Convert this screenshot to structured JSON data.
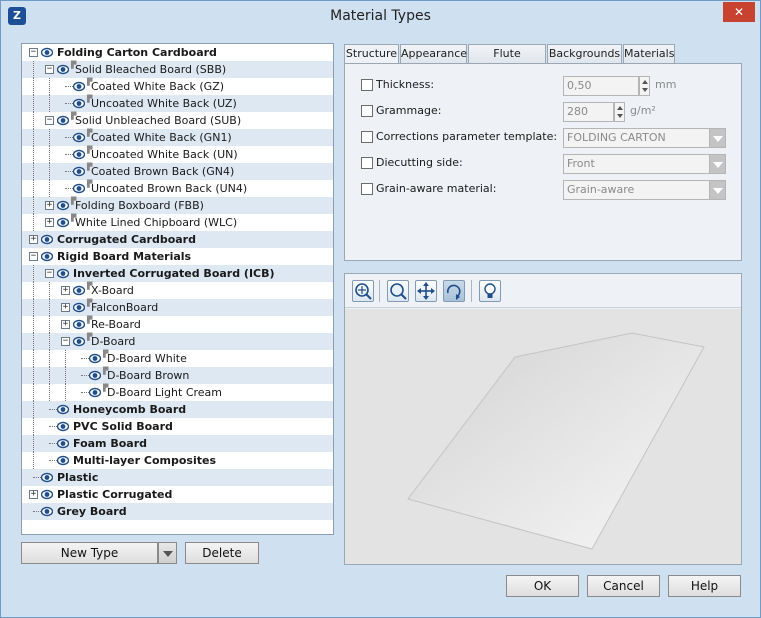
{
  "window": {
    "title": "Material Types",
    "icon_name": "app-logo-icon",
    "close_glyph": "✕"
  },
  "tree": [
    {
      "label": "Folding Carton Cardboard",
      "level": 0,
      "expander": "minus",
      "bold": true,
      "flag": false
    },
    {
      "label": "Solid Bleached Board (SBB)",
      "level": 1,
      "expander": "minus",
      "bold": false,
      "flag": true
    },
    {
      "label": "Coated White Back (GZ)",
      "level": 2,
      "expander": "none",
      "bold": false,
      "flag": true
    },
    {
      "label": "Uncoated White Back (UZ)",
      "level": 2,
      "expander": "none",
      "bold": false,
      "flag": true
    },
    {
      "label": "Solid Unbleached Board (SUB)",
      "level": 1,
      "expander": "minus",
      "bold": false,
      "flag": true
    },
    {
      "label": "Coated White Back (GN1)",
      "level": 2,
      "expander": "none",
      "bold": false,
      "flag": true
    },
    {
      "label": "Uncoated White Back (UN)",
      "level": 2,
      "expander": "none",
      "bold": false,
      "flag": true
    },
    {
      "label": "Coated Brown Back (GN4)",
      "level": 2,
      "expander": "none",
      "bold": false,
      "flag": true
    },
    {
      "label": "Uncoated Brown Back (UN4)",
      "level": 2,
      "expander": "none",
      "bold": false,
      "flag": true
    },
    {
      "label": "Folding Boxboard (FBB)",
      "level": 1,
      "expander": "plus",
      "bold": false,
      "flag": true
    },
    {
      "label": "White Lined Chipboard (WLC)",
      "level": 1,
      "expander": "plus",
      "bold": false,
      "flag": true
    },
    {
      "label": "Corrugated Cardboard",
      "level": 0,
      "expander": "plus",
      "bold": true,
      "flag": false
    },
    {
      "label": "Rigid Board Materials",
      "level": 0,
      "expander": "minus",
      "bold": true,
      "flag": false
    },
    {
      "label": "Inverted Corrugated Board (ICB)",
      "level": 1,
      "expander": "minus",
      "bold": true,
      "flag": false
    },
    {
      "label": "X-Board",
      "level": 2,
      "expander": "plus",
      "bold": false,
      "flag": true
    },
    {
      "label": "FalconBoard",
      "level": 2,
      "expander": "plus",
      "bold": false,
      "flag": true
    },
    {
      "label": "Re-Board",
      "level": 2,
      "expander": "plus",
      "bold": false,
      "flag": true
    },
    {
      "label": "D-Board",
      "level": 2,
      "expander": "minus",
      "bold": false,
      "flag": true
    },
    {
      "label": "D-Board White",
      "level": 3,
      "expander": "none",
      "bold": false,
      "flag": true
    },
    {
      "label": "D-Board Brown",
      "level": 3,
      "expander": "none",
      "bold": false,
      "flag": true
    },
    {
      "label": "D-Board Light Cream",
      "level": 3,
      "expander": "none",
      "bold": false,
      "flag": true
    },
    {
      "label": "Honeycomb Board",
      "level": 1,
      "expander": "none",
      "bold": true,
      "flag": false
    },
    {
      "label": "PVC Solid Board",
      "level": 1,
      "expander": "none",
      "bold": true,
      "flag": false
    },
    {
      "label": "Foam Board",
      "level": 1,
      "expander": "none",
      "bold": true,
      "flag": false
    },
    {
      "label": "Multi-layer Composites",
      "level": 1,
      "expander": "none",
      "bold": true,
      "flag": false
    },
    {
      "label": "Plastic",
      "level": 0,
      "expander": "none",
      "bold": true,
      "flag": false
    },
    {
      "label": "Plastic Corrugated",
      "level": 0,
      "expander": "plus",
      "bold": true,
      "flag": false
    },
    {
      "label": "Grey Board",
      "level": 0,
      "expander": "none",
      "bold": true,
      "flag": false
    }
  ],
  "left_buttons": {
    "new_type": "New Type",
    "delete": "Delete"
  },
  "tabs": [
    "Structure",
    "Appearance",
    "Flute Symbols",
    "Backgrounds",
    "Materials"
  ],
  "active_tab": "Structure",
  "structure": {
    "thickness": {
      "label": "Thickness:",
      "value": "0,50",
      "unit": "mm",
      "checked": false
    },
    "grammage": {
      "label": "Grammage:",
      "value": "280",
      "unit": "g/m²",
      "checked": false
    },
    "corrections": {
      "label": "Corrections parameter template:",
      "value": "FOLDING CARTON",
      "checked": false
    },
    "diecutting": {
      "label": "Diecutting side:",
      "value": "Front",
      "checked": false
    },
    "grain": {
      "label": "Grain-aware material:",
      "value": "Grain-aware",
      "checked": false
    }
  },
  "preview_toolbar": [
    "zoom-fit-icon",
    "zoom-icon",
    "pan-icon",
    "rotate-icon",
    "light-bulb-icon"
  ],
  "dialog_buttons": {
    "ok": "OK",
    "cancel": "Cancel",
    "help": "Help"
  },
  "colors": {
    "window_bg": "#cfe0f0",
    "eye_blue": "#1f4e8c",
    "close_red": "#c7432f"
  }
}
